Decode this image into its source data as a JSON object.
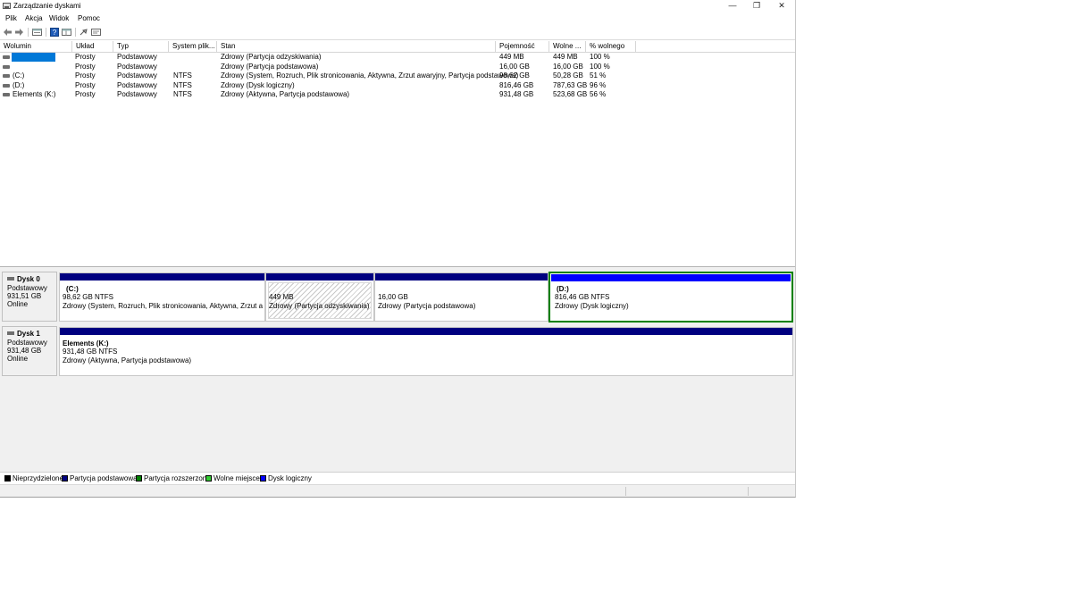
{
  "window": {
    "title": "Zarządzanie dyskami",
    "controls": {
      "minimize": "—",
      "restore": "❐",
      "close": "✕"
    }
  },
  "menu": [
    "Plik",
    "Akcja",
    "Widok",
    "Pomoc"
  ],
  "toolbar": {
    "icons": [
      "back-arrow-icon",
      "forward-arrow-icon",
      "volume-list-icon",
      "help-icon",
      "properties-icon",
      "connect-icon",
      "settings-icon"
    ]
  },
  "volume_table": {
    "headers": [
      "Wolumin",
      "Układ",
      "Typ",
      "System plik...",
      "Stan",
      "Pojemność",
      "Wolne ...",
      "% wolnego"
    ],
    "rows": [
      {
        "name": "",
        "layout": "Prosty",
        "type": "Podstawowy",
        "fs": "",
        "status": "Zdrowy (Partycja odzyskiwania)",
        "capacity": "449 MB",
        "free": "449 MB",
        "pct": "100 %"
      },
      {
        "name": "",
        "layout": "Prosty",
        "type": "Podstawowy",
        "fs": "",
        "status": "Zdrowy (Partycja podstawowa)",
        "capacity": "16,00 GB",
        "free": "16,00 GB",
        "pct": "100 %"
      },
      {
        "name": "(C:)",
        "layout": "Prosty",
        "type": "Podstawowy",
        "fs": "NTFS",
        "status": "Zdrowy (System, Rozruch, Plik stronicowania, Aktywna, Zrzut awaryjny, Partycja podstawowa)",
        "capacity": "98,62 GB",
        "free": "50,28 GB",
        "pct": "51 %"
      },
      {
        "name": "(D:)",
        "layout": "Prosty",
        "type": "Podstawowy",
        "fs": "NTFS",
        "status": "Zdrowy (Dysk logiczny)",
        "capacity": "816,46 GB",
        "free": "787,63 GB",
        "pct": "96 %"
      },
      {
        "name": "Elements (K:)",
        "layout": "Prosty",
        "type": "Podstawowy",
        "fs": "NTFS",
        "status": "Zdrowy (Aktywna, Partycja podstawowa)",
        "capacity": "931,48 GB",
        "free": "523,68 GB",
        "pct": "56 %"
      }
    ]
  },
  "disks": [
    {
      "name": "Dysk 0",
      "type": "Podstawowy",
      "size": "931,51 GB",
      "state": "Online",
      "partitions": [
        {
          "title": "(C:)",
          "size": "98,62 GB NTFS",
          "status": "Zdrowy (System, Rozruch, Plik stronicowania, Aktywna, Zrzut awaryj"
        },
        {
          "title": "",
          "size": "449 MB",
          "status": "Zdrowy (Partycja odzyskiwania)"
        },
        {
          "title": "",
          "size": "16,00 GB",
          "status": "Zdrowy (Partycja podstawowa)"
        },
        {
          "title": "(D:)",
          "size": "816,46 GB NTFS",
          "status": "Zdrowy (Dysk logiczny)"
        }
      ]
    },
    {
      "name": "Dysk 1",
      "type": "Podstawowy",
      "size": "931,48 GB",
      "state": "Online",
      "partitions": [
        {
          "title": "Elements  (K:)",
          "size": "931,48 GB NTFS",
          "status": "Zdrowy (Aktywna, Partycja podstawowa)"
        }
      ]
    }
  ],
  "legend": [
    {
      "label": "Nieprzydzielone",
      "color": "#000000"
    },
    {
      "label": "Partycja podstawowa",
      "color": "#000080"
    },
    {
      "label": "Partycja rozszerzona",
      "color": "#008000"
    },
    {
      "label": "Wolne miejsce",
      "color": "#33cc33"
    },
    {
      "label": "Dysk logiczny",
      "color": "#0000ff"
    }
  ],
  "colors": {
    "primary_partition": "#000080",
    "logical_drive": "#0000ff",
    "extended_partition": "#008000",
    "selection": "#0078d7"
  }
}
